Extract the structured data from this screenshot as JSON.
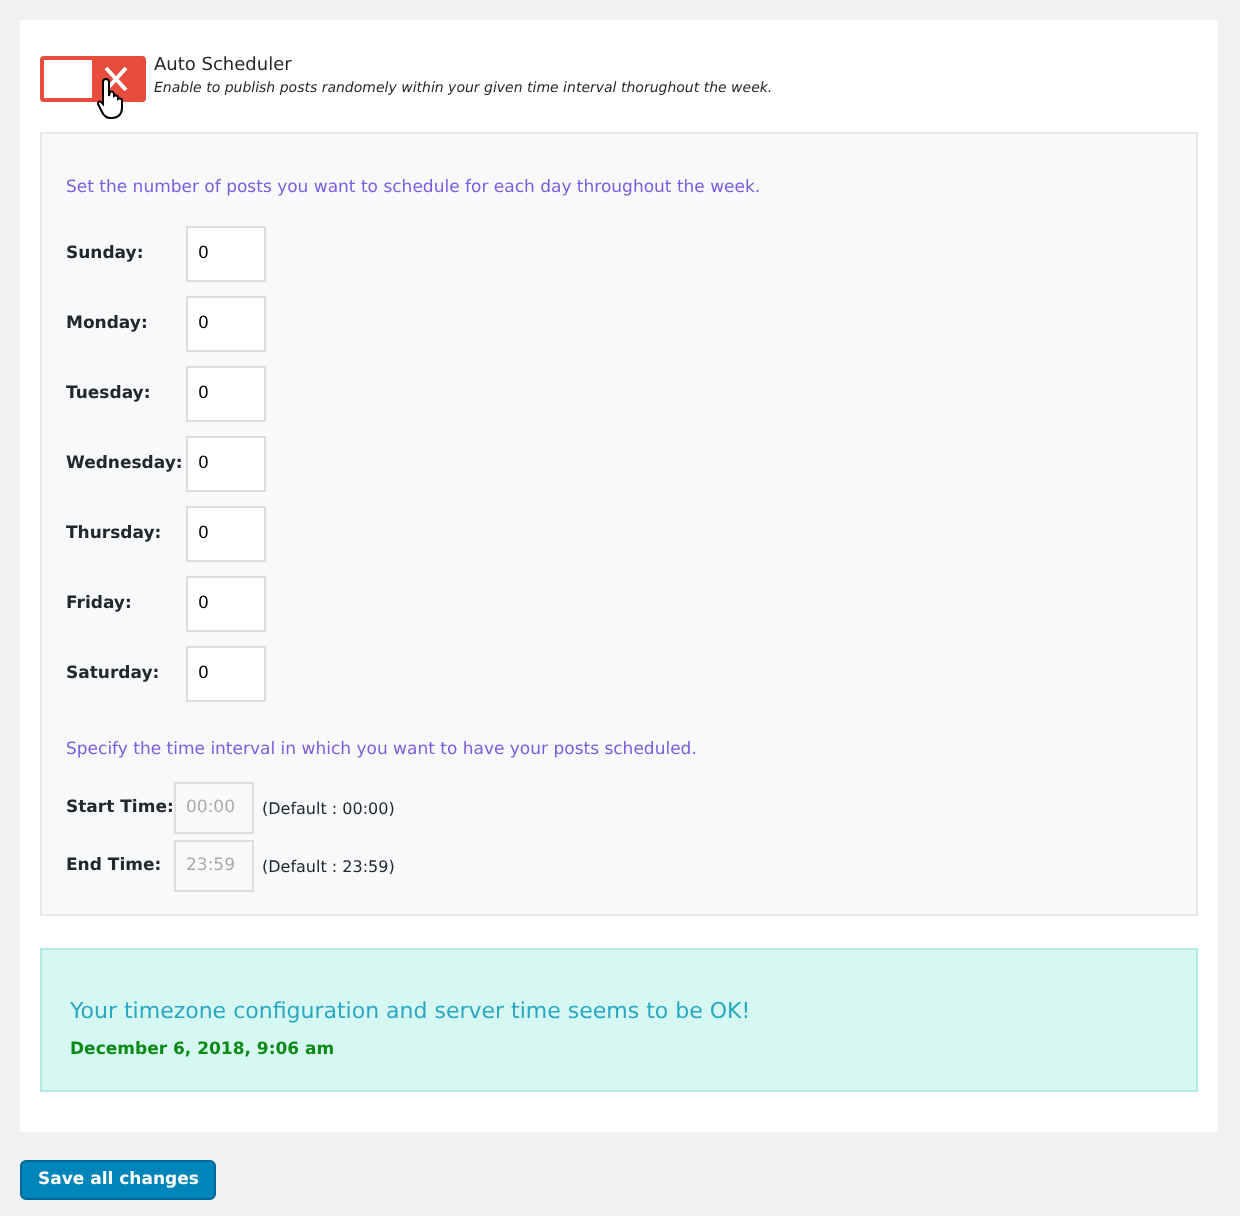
{
  "toggle": {
    "on": false,
    "title": "Auto Scheduler",
    "description": "Enable to publish posts randomely within your given time interval thorughout the week."
  },
  "posts_heading": "Set the number of posts you want to schedule for each day throughout the week.",
  "days": [
    {
      "label": "Sunday:",
      "value": "0"
    },
    {
      "label": "Monday:",
      "value": "0"
    },
    {
      "label": "Tuesday:",
      "value": "0"
    },
    {
      "label": "Wednesday:",
      "value": "0"
    },
    {
      "label": "Thursday:",
      "value": "0"
    },
    {
      "label": "Friday:",
      "value": "0"
    },
    {
      "label": "Saturday:",
      "value": "0"
    }
  ],
  "interval_heading": "Specify the time interval in which you want to have your posts scheduled.",
  "times": [
    {
      "label": "Start Time:",
      "placeholder": "00:00",
      "default": "(Default : 00:00)"
    },
    {
      "label": "End Time:",
      "placeholder": "23:59",
      "default": "(Default : 23:59)"
    }
  ],
  "notice": {
    "message": "Your timezone configuration and server time seems to be OK!",
    "time": "December 6, 2018, 9:06 am"
  },
  "save_button": "Save all changes"
}
